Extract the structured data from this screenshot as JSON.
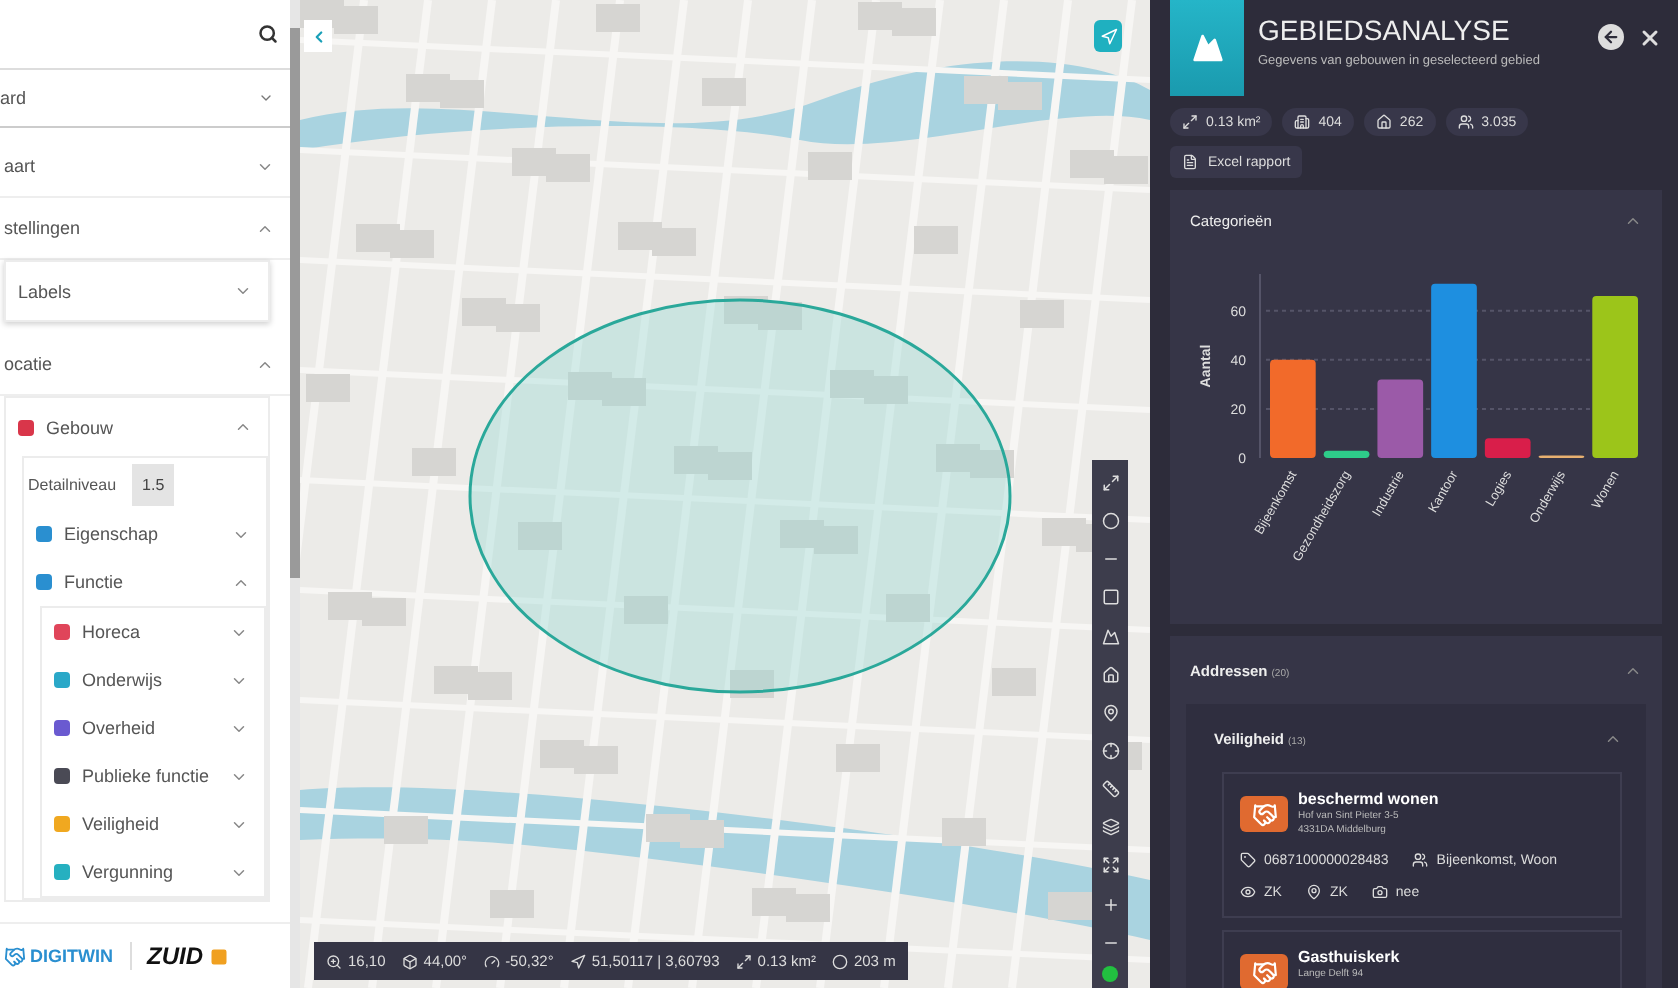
{
  "sidebar": {
    "select_value": "ard",
    "items": [
      {
        "label": "aart",
        "expanded": false
      },
      {
        "label": "stellingen",
        "expanded": true,
        "children": [
          {
            "label": "Labels",
            "expanded": false
          }
        ]
      },
      {
        "label": "ocatie",
        "expanded": true,
        "children": [
          {
            "label": "Gebouw",
            "color": "#d9364a",
            "expanded": true,
            "setting": {
              "label": "Detailniveau",
              "value": "1.5"
            },
            "children": [
              {
                "label": "Eigenschap",
                "color": "#2a8fd0",
                "expanded": false
              },
              {
                "label": "Functie",
                "color": "#2a8fd0",
                "expanded": true,
                "children": [
                  {
                    "label": "Horeca",
                    "color": "#e0455a",
                    "expanded": false
                  },
                  {
                    "label": "Onderwijs",
                    "color": "#2aa8c8",
                    "expanded": false
                  },
                  {
                    "label": "Overheid",
                    "color": "#6a5ad0",
                    "expanded": false
                  },
                  {
                    "label": "Publieke functie",
                    "color": "#4a4a55",
                    "expanded": false
                  },
                  {
                    "label": "Veiligheid",
                    "color": "#f0a820",
                    "expanded": false
                  },
                  {
                    "label": "Vergunning",
                    "color": "#26b0c0",
                    "expanded": false
                  }
                ]
              }
            ]
          }
        ]
      }
    ],
    "logos": [
      "DIGITWIN",
      "ZUID"
    ]
  },
  "status_bar": [
    "16,10",
    "44,00°",
    "-50,32°",
    "51,50117 | 3,60793",
    "0.13 km²",
    "203 m"
  ],
  "panel": {
    "title": "GEBIEDSANALYSE",
    "subtitle": "Gegevens van gebouwen in geselecteerd gebied",
    "stats": [
      "0.13 km²",
      "404",
      "262",
      "3.035"
    ],
    "export_button": "Excel rapport",
    "categories": {
      "title": "Categorieën",
      "expanded": true,
      "bars": [
        {
          "color": "#f26a2a"
        },
        {
          "color": "#2ecc8a"
        },
        {
          "color": "#9b5aa8"
        },
        {
          "color": "#1e8fe0"
        },
        {
          "color": "#d91e4a"
        },
        {
          "color": "#e8b070"
        },
        {
          "color": "#9cc51a"
        }
      ],
      "chart_data": {
        "type": "bar",
        "ylabel": "Aantal",
        "categories": [
          "Bijeenkomst",
          "Gezondheidszorg",
          "Industrie",
          "Kantoor",
          "Logies",
          "Onderwijs",
          "Wonen"
        ],
        "series": [
          {
            "values": [
              40,
              3,
              32,
              71,
              8,
              1,
              66
            ]
          }
        ],
        "ylim": [
          0,
          75
        ],
        "yticks": [
          0,
          20,
          40,
          60
        ],
        "grid": true
      }
    },
    "addresses": {
      "title": "Addressen",
      "count": "(20)",
      "expanded": true,
      "groups": [
        {
          "title": "Veiligheid",
          "count": "(13)",
          "expanded": true,
          "cards": [
            {
              "name": "beschermd wonen",
              "street": "Hof van Sint Pieter 3-5",
              "city": "4331DA Middelburg",
              "id": "0687100000028483",
              "functions": "Bijeenkomst, Woon",
              "tags": [
                "ZK",
                "ZK",
                "nee"
              ]
            },
            {
              "name": "Gasthuiskerk",
              "street": "Lange Delft 94"
            }
          ]
        }
      ]
    }
  }
}
